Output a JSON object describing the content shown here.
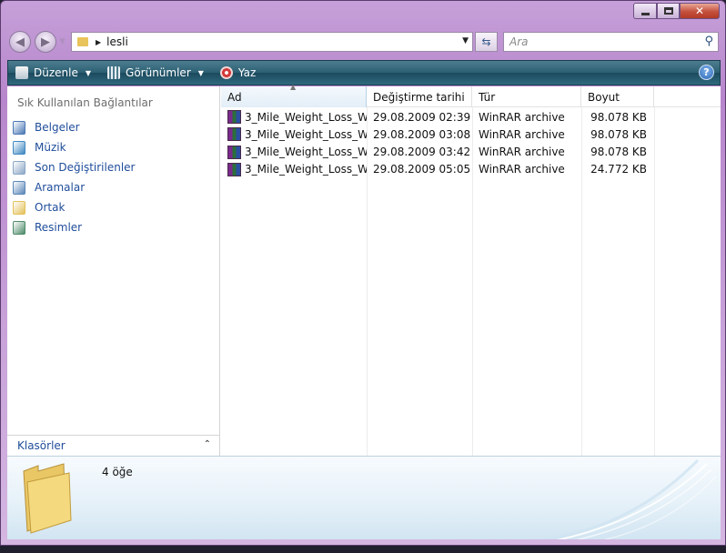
{
  "window": {
    "controls": {
      "minimize_icon": "minimize-icon",
      "maximize_icon": "maximize-icon",
      "close_icon": "close-icon"
    }
  },
  "address_bar": {
    "path": "lesli",
    "search_placeholder": "Ara"
  },
  "toolbar": {
    "organize": "Düzenle",
    "views": "Görünümler",
    "burn": "Yaz"
  },
  "nav_pane": {
    "title": "Sık Kullanılan Bağlantılar",
    "items": [
      {
        "label": "Belgeler",
        "icon": "documents-icon",
        "color": "#4a78b5"
      },
      {
        "label": "Müzik",
        "icon": "music-icon",
        "color": "#3f88c2"
      },
      {
        "label": "Son Değiştirilenler",
        "icon": "recent-icon",
        "color": "#8aa7c6"
      },
      {
        "label": "Aramalar",
        "icon": "search-icon",
        "color": "#5a86b8"
      },
      {
        "label": "Ortak",
        "icon": "public-folder-icon",
        "color": "#e3c15a"
      },
      {
        "label": "Resimler",
        "icon": "pictures-icon",
        "color": "#4e8b6a"
      }
    ],
    "folders_label": "Klasörler"
  },
  "columns": {
    "name": "Ad",
    "modified": "Değiştirme tarihi",
    "type": "Tür",
    "size": "Boyut"
  },
  "files": [
    {
      "name": "3_Mile_Weight_Loss_W...",
      "modified": "29.08.2009 02:39",
      "type": "WinRAR archive",
      "size": "98.078 KB"
    },
    {
      "name": "3_Mile_Weight_Loss_W...",
      "modified": "29.08.2009 03:08",
      "type": "WinRAR archive",
      "size": "98.078 KB"
    },
    {
      "name": "3_Mile_Weight_Loss_W...",
      "modified": "29.08.2009 03:42",
      "type": "WinRAR archive",
      "size": "98.078 KB"
    },
    {
      "name": "3_Mile_Weight_Loss_W...",
      "modified": "29.08.2009 05:05",
      "type": "WinRAR archive",
      "size": "24.772 KB"
    }
  ],
  "details": {
    "item_count": "4 öğe"
  },
  "colors": {
    "frame": "#c6a0d8",
    "toolbar": "#2c5f73",
    "link": "#1f4d9b"
  }
}
